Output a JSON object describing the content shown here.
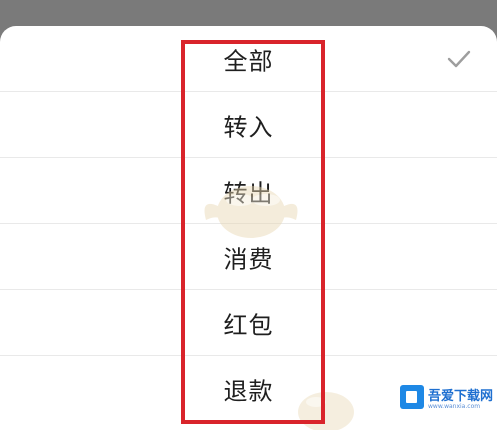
{
  "filter_sheet": {
    "options": [
      {
        "label": "全部",
        "selected": true
      },
      {
        "label": "转入",
        "selected": false
      },
      {
        "label": "转出",
        "selected": false
      },
      {
        "label": "消费",
        "selected": false
      },
      {
        "label": "红包",
        "selected": false
      },
      {
        "label": "退款",
        "selected": false
      }
    ],
    "highlight_color": "#d9242b",
    "check_color": "#9e9e9e"
  },
  "watermark": {
    "brand": "吾爱下载网",
    "url": "www.wanxia.com"
  }
}
